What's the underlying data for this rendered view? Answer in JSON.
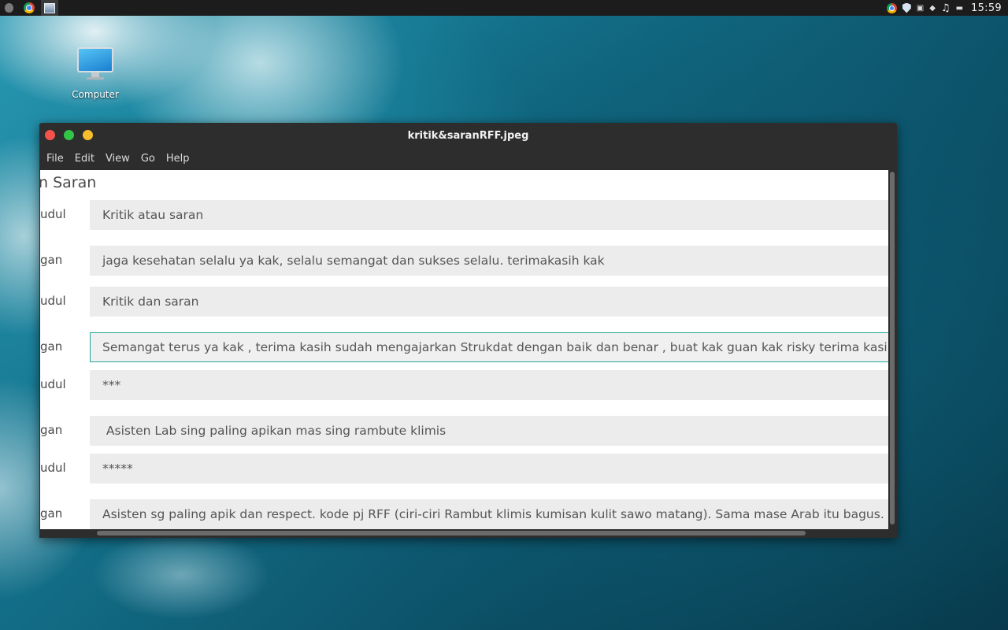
{
  "desktop": {
    "icon_label": "Computer"
  },
  "panel": {
    "clock": "15:59",
    "tray_icons": [
      "chrome-icon",
      "shield-icon",
      "device-icon",
      "wifi-icon",
      "music-note-icon",
      "battery-icon"
    ]
  },
  "window": {
    "title": "kritik&saranRFF.jpeg",
    "menu": [
      "File",
      "Edit",
      "View",
      "Go",
      "Help"
    ]
  },
  "form": {
    "heading": "n Saran",
    "rows": [
      {
        "label": "udul",
        "value": "Kritik atau saran"
      },
      {
        "label": "gan",
        "value": "jaga kesehatan selalu ya kak, selalu semangat dan sukses selalu. terimakasih kak"
      },
      {
        "label": "udul",
        "value": "Kritik dan saran"
      },
      {
        "label": "gan",
        "value": "Semangat terus ya kak , terima kasih sudah mengajarkan Strukdat dengan baik dan benar , buat kak guan kak risky terima kasihh b"
      },
      {
        "label": "udul",
        "value": "***"
      },
      {
        "label": "gan",
        "value": " Asisten Lab sing paling apikan mas sing rambute klimis"
      },
      {
        "label": "udul",
        "value": "*****"
      },
      {
        "label": "gan",
        "value": "Asisten sg paling apik dan respect. kode pj RFF (ciri-ciri Rambut klimis kumisan kulit sawo matang). Sama mase Arab itu bagus. yg la"
      }
    ]
  }
}
